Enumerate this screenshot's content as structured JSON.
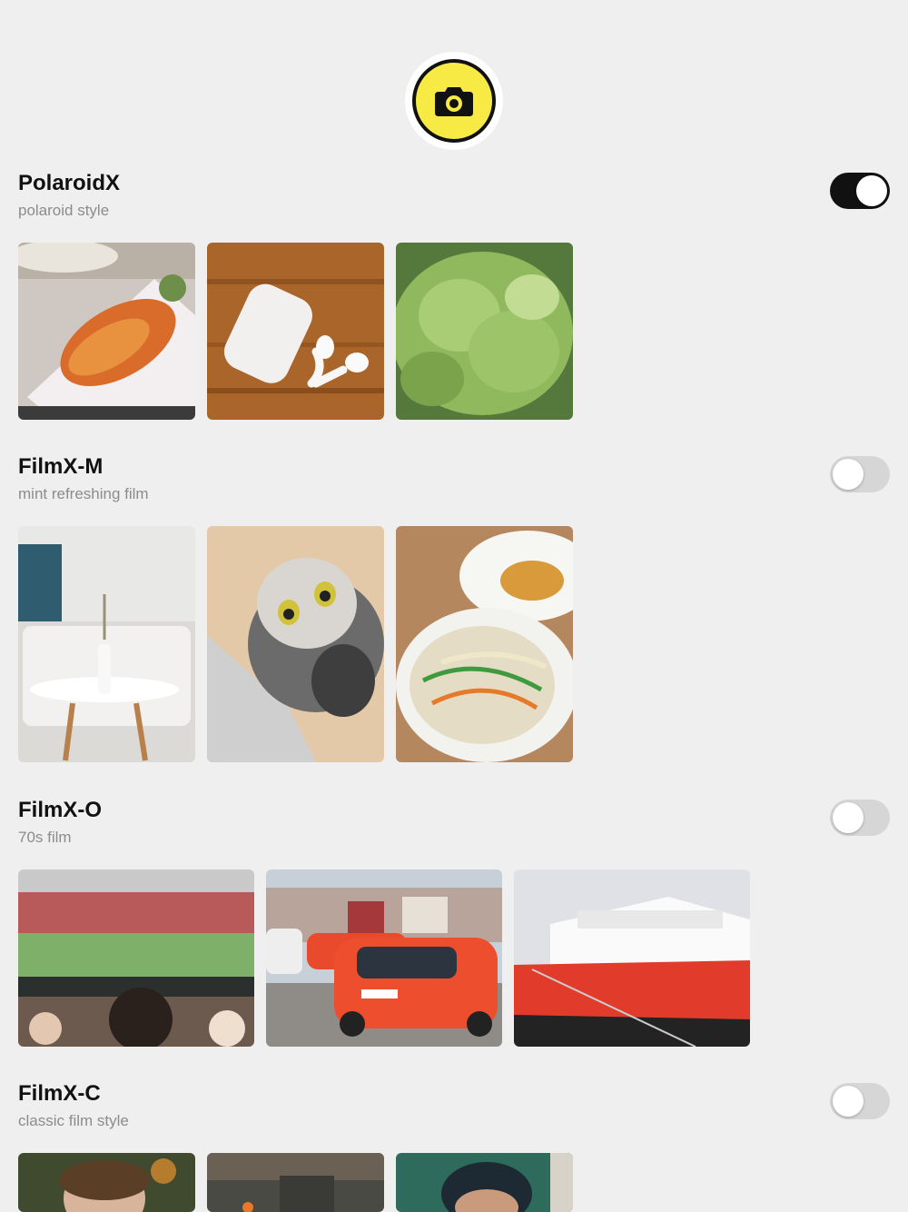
{
  "camera_button": {
    "icon": "camera-icon",
    "color": "#f8ea45"
  },
  "filters": [
    {
      "name": "PolaroidX",
      "description": "polaroid style",
      "enabled": true,
      "photos": [
        "fried dumplings on plate",
        "airpods on wooden table",
        "lettuce in bowl"
      ]
    },
    {
      "name": "FilmX-M",
      "description": "mint refreshing film",
      "enabled": false,
      "photos": [
        "white room with side table",
        "tabby cat looking up",
        "noodle soup with gyoza"
      ]
    },
    {
      "name": "FilmX-O",
      "description": "70s film",
      "enabled": false,
      "photos": [
        "football stadium crowd",
        "red police cars on cobblestone street",
        "red and white ship at dock"
      ]
    },
    {
      "name": "FilmX-C",
      "description": "classic film style",
      "enabled": false,
      "photos": [
        "portrait of person with flowers",
        "street scene",
        "portrait with cap"
      ]
    }
  ],
  "colors": {
    "toggle_on": "#111111",
    "toggle_off": "#d6d6d6",
    "background": "#efefef"
  }
}
